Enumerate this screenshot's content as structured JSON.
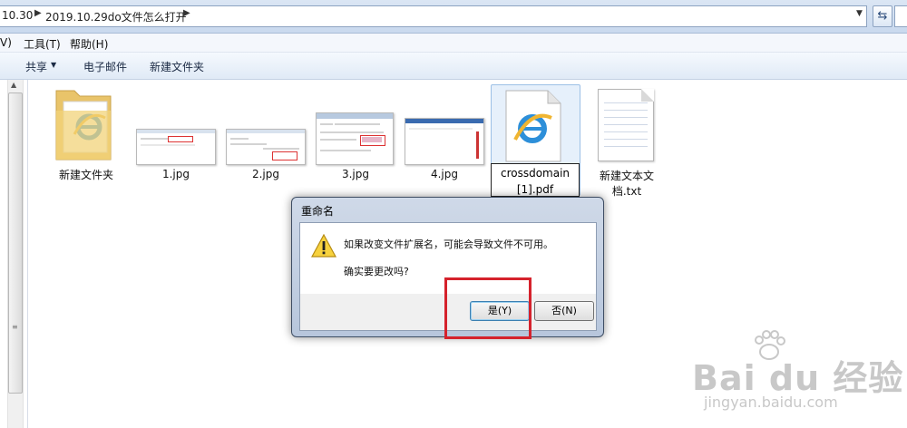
{
  "address_bar": {
    "crumbs": [
      "10.30",
      "2019.10.29do文件怎么打开"
    ]
  },
  "menu": {
    "items": [
      "V)",
      "工具(T)",
      "帮助(H)"
    ]
  },
  "toolbar": {
    "share_label": "共享",
    "email_label": "电子邮件",
    "new_folder_label": "新建文件夹"
  },
  "files": [
    {
      "name": "新建文件夹",
      "type": "folder"
    },
    {
      "name": "1.jpg",
      "type": "image"
    },
    {
      "name": "2.jpg",
      "type": "image"
    },
    {
      "name": "3.jpg",
      "type": "image"
    },
    {
      "name": "4.jpg",
      "type": "image"
    },
    {
      "name_line1": "crossdomain",
      "name_line2": "[1].pdf",
      "type": "ie-file",
      "selected": true
    },
    {
      "name": "新建文本文档.txt",
      "type": "text"
    }
  ],
  "dialog": {
    "title": "重命名",
    "message": "如果改变文件扩展名，可能会导致文件不可用。",
    "question": "确实要更改吗?",
    "yes_label": "是(Y)",
    "no_label": "否(N)"
  },
  "watermark": {
    "brand_text": "Bai du 经验",
    "url": "jingyan.baidu.com"
  },
  "colors": {
    "highlight_red": "#d5222c",
    "dialog_frame": "#b7c6dc",
    "toolbar_bg": "#e0eaf6"
  }
}
